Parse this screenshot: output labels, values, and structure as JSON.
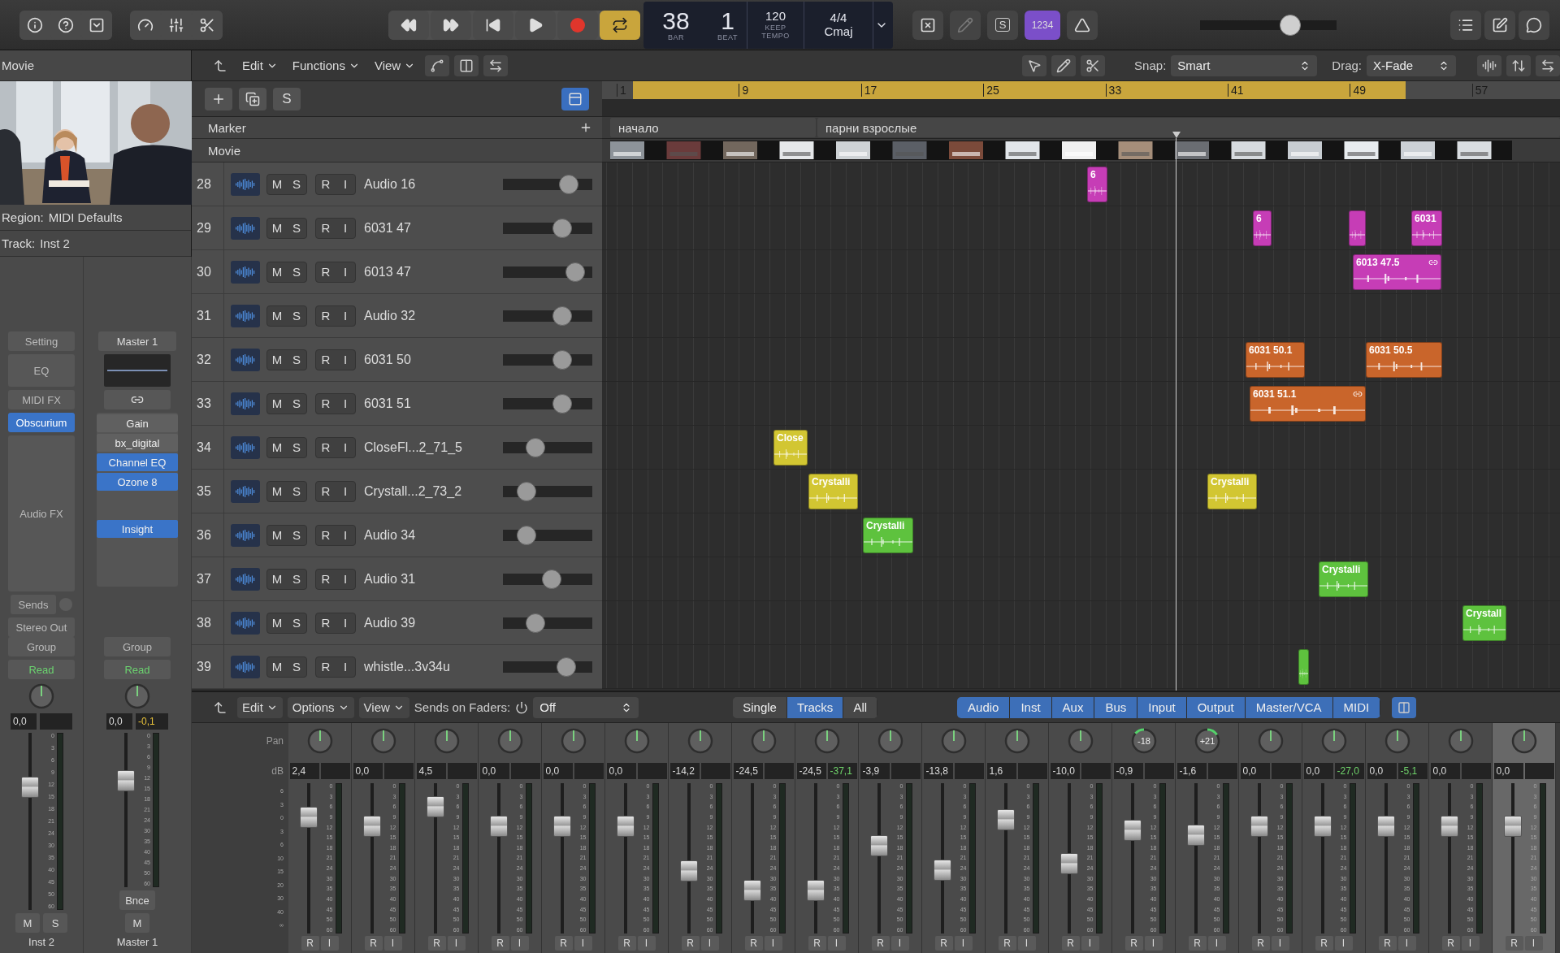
{
  "top_toolbar": {
    "lcd": {
      "bar": "38",
      "bar_label": "BAR",
      "beat": "1",
      "beat_label": "BEAT",
      "tempo": "120",
      "tempo_mode": "KEEP",
      "tempo_label": "TEMPO",
      "signature": "4/4",
      "key": "Cmaj"
    },
    "cycle": {
      "on": true
    },
    "solo_label": "S",
    "count_in": {
      "label": "1234",
      "on": true
    },
    "master_volume": {
      "level": 0.69
    }
  },
  "inspector": {
    "title": "Movie",
    "region": {
      "label": "Region:",
      "value": "MIDI Defaults"
    },
    "track": {
      "label": "Track:",
      "value": "Inst 2"
    },
    "strips": [
      {
        "kind": "instrument",
        "setting": "Setting",
        "eq": "EQ",
        "midi_fx": "MIDI FX",
        "instrument": "Obscurium",
        "audio_fx": "Audio FX",
        "sends": "Sends",
        "output": "Stereo Out",
        "group": "Group",
        "automation": "Read",
        "volume": "0,0",
        "fader": {
          "level": 0.72
        },
        "meter_scale": [
          "0",
          "3",
          "6",
          "9",
          "12",
          "15",
          "18",
          "21",
          "24",
          "30",
          "35",
          "40",
          "45",
          "50",
          "60"
        ],
        "buttons": [
          "M",
          "S"
        ],
        "name": "Inst 2"
      },
      {
        "kind": "master",
        "setting": "Master 1",
        "plugins": [
          {
            "label": "Gain",
            "active": false
          },
          {
            "label": "bx_digital",
            "active": false
          },
          {
            "label": "Channel EQ",
            "active": true
          },
          {
            "label": "Ozone 8",
            "active": true
          }
        ],
        "lower_plugins": [
          {
            "label": "Insight",
            "active": true
          }
        ],
        "group": "Group",
        "automation": "Read",
        "volume": "0,0",
        "peak": "-0,1",
        "fader": {
          "level": 0.72
        },
        "meter_scale": [
          "0",
          "3",
          "6",
          "9",
          "12",
          "15",
          "18",
          "21",
          "24",
          "30",
          "35",
          "40",
          "45",
          "50",
          "60"
        ],
        "bounce": "Bnce",
        "buttons": [
          "M"
        ],
        "name": "Master 1"
      }
    ]
  },
  "arrange": {
    "menus": [
      "Edit",
      "Functions",
      "View"
    ],
    "snap": {
      "label": "Snap:",
      "value": "Smart"
    },
    "drag": {
      "label": "Drag:",
      "value": "X-Fade"
    },
    "solo_label": "S",
    "ruler": [
      "1",
      "9",
      "17",
      "25",
      "33",
      "41",
      "49",
      "57"
    ],
    "global_tracks": [
      "Marker",
      "Movie"
    ],
    "markers": [
      "начало",
      "парни взрослые"
    ],
    "tracks": [
      {
        "number": "28",
        "name": "Audio 16",
        "buttons": [
          "M",
          "S",
          "R",
          "I"
        ],
        "volume": {
          "level": 0.8
        },
        "regions": [
          {
            "name": "6",
            "color": "#c63db6",
            "linked": false
          }
        ]
      },
      {
        "number": "29",
        "name": "6031 47",
        "buttons": [
          "M",
          "S",
          "R",
          "I"
        ],
        "volume": {
          "level": 0.71
        },
        "regions": [
          {
            "name": "6",
            "color": "#c63db6",
            "linked": false
          },
          {
            "color": "#c63db6",
            "linked": false
          },
          {
            "name": "6031",
            "color": "#c63db6",
            "linked": false
          }
        ]
      },
      {
        "number": "30",
        "name": "6013 47",
        "buttons": [
          "M",
          "S",
          "R",
          "I"
        ],
        "volume": {
          "level": 0.89
        },
        "regions": [
          {
            "name": "6013 47.5",
            "color": "#c63db6",
            "linked": true
          }
        ]
      },
      {
        "number": "31",
        "name": "Audio 32",
        "buttons": [
          "M",
          "S",
          "R",
          "I"
        ],
        "volume": {
          "level": 0.71
        }
      },
      {
        "number": "32",
        "name": "6031 50",
        "buttons": [
          "M",
          "S",
          "R",
          "I"
        ],
        "volume": {
          "level": 0.71
        },
        "regions": [
          {
            "name": "6031 50.1",
            "color": "#c9652b",
            "linked": false
          },
          {
            "name": "6031 50.5",
            "color": "#c9652b",
            "linked": false
          }
        ]
      },
      {
        "number": "33",
        "name": "6031 51",
        "buttons": [
          "M",
          "S",
          "R",
          "I"
        ],
        "volume": {
          "level": 0.71
        },
        "regions": [
          {
            "name": "6031 51.1",
            "color": "#c9652b",
            "linked": true
          }
        ]
      },
      {
        "number": "34",
        "name": "CloseFl...2_71_5",
        "buttons": [
          "M",
          "S",
          "R",
          "I"
        ],
        "volume": {
          "level": 0.32
        },
        "regions": [
          {
            "name": "Close",
            "color": "#d2c632",
            "linked": false
          }
        ]
      },
      {
        "number": "35",
        "name": "Crystall...2_73_2",
        "buttons": [
          "M",
          "S",
          "R",
          "I"
        ],
        "volume": {
          "level": 0.2
        },
        "regions": [
          {
            "name": "Crystalli",
            "color": "#d2c632",
            "linked": false
          },
          {
            "name": "Crystalli",
            "color": "#d2c632",
            "linked": false
          }
        ]
      },
      {
        "number": "36",
        "name": "Audio 34",
        "buttons": [
          "M",
          "S",
          "R",
          "I"
        ],
        "volume": {
          "level": 0.2
        },
        "regions": [
          {
            "name": "Crystalli",
            "color": "#5ec23e",
            "linked": false
          }
        ]
      },
      {
        "number": "37",
        "name": "Audio 31",
        "buttons": [
          "M",
          "S",
          "R",
          "I"
        ],
        "volume": {
          "level": 0.56
        },
        "regions": [
          {
            "name": "Crystalli",
            "color": "#5ec23e",
            "linked": false
          }
        ]
      },
      {
        "number": "38",
        "name": "Audio 39",
        "buttons": [
          "M",
          "S",
          "R",
          "I"
        ],
        "volume": {
          "level": 0.33
        },
        "regions": [
          {
            "name": "Crystall",
            "color": "#5ec23e",
            "linked": false
          }
        ]
      },
      {
        "number": "39",
        "name": "whistle...3v34u",
        "buttons": [
          "M",
          "S",
          "R",
          "I"
        ],
        "volume": {
          "level": 0.77
        },
        "regions": [
          {
            "color": "#5ec23e",
            "linked": false
          }
        ]
      }
    ]
  },
  "mixer": {
    "menus": [
      "Edit",
      "Options",
      "View"
    ],
    "sends_label": "Sends on Faders:",
    "sends_value": "Off",
    "views": [
      {
        "label": "Single",
        "selected": false
      },
      {
        "label": "Tracks",
        "selected": true
      },
      {
        "label": "All",
        "selected": false
      }
    ],
    "filters": [
      {
        "label": "Audio",
        "on": true
      },
      {
        "label": "Inst",
        "on": true
      },
      {
        "label": "Aux",
        "on": true
      },
      {
        "label": "Bus",
        "on": true
      },
      {
        "label": "Input",
        "on": true
      },
      {
        "label": "Output",
        "on": true
      },
      {
        "label": "Master/VCA",
        "on": true
      },
      {
        "label": "MIDI",
        "on": true
      }
    ],
    "pan_label": "Pan",
    "db_label": "dB",
    "fader_scale": [
      "6",
      "3",
      "0",
      "3",
      "6",
      "10",
      "15",
      "20",
      "30",
      "40",
      "∞"
    ],
    "strips": [
      {
        "volume": "2,4",
        "fader": {
          "level": 0.82
        },
        "meter_scale": [
          "0",
          "3",
          "6",
          "9",
          "12",
          "15",
          "18",
          "21",
          "24",
          "30",
          "35",
          "40",
          "45",
          "50",
          "60"
        ],
        "buttons": [
          "R",
          "I"
        ],
        "selected": false
      },
      {
        "volume": "0,0",
        "fader": {
          "level": 0.75
        },
        "meter_scale": [
          "0",
          "3",
          "6",
          "9",
          "12",
          "15",
          "18",
          "21",
          "24",
          "30",
          "35",
          "40",
          "45",
          "50",
          "60"
        ],
        "buttons": [
          "R",
          "I"
        ],
        "selected": false
      },
      {
        "volume": "4,5",
        "fader": {
          "level": 0.9
        },
        "meter_scale": [
          "0",
          "3",
          "6",
          "9",
          "12",
          "15",
          "18",
          "21",
          "24",
          "30",
          "35",
          "40",
          "45",
          "50",
          "60"
        ],
        "buttons": [
          "R",
          "I"
        ],
        "selected": false
      },
      {
        "volume": "0,0",
        "fader": {
          "level": 0.75
        },
        "meter_scale": [
          "0",
          "3",
          "6",
          "9",
          "12",
          "15",
          "18",
          "21",
          "24",
          "30",
          "35",
          "40",
          "45",
          "50",
          "60"
        ],
        "buttons": [
          "R",
          "I"
        ],
        "selected": false
      },
      {
        "volume": "0,0",
        "fader": {
          "level": 0.75
        },
        "meter_scale": [
          "0",
          "3",
          "6",
          "9",
          "12",
          "15",
          "18",
          "21",
          "24",
          "30",
          "35",
          "40",
          "45",
          "50",
          "60"
        ],
        "buttons": [
          "R",
          "I"
        ],
        "selected": false
      },
      {
        "volume": "0,0",
        "fader": {
          "level": 0.75
        },
        "meter_scale": [
          "0",
          "3",
          "6",
          "9",
          "12",
          "15",
          "18",
          "21",
          "24",
          "30",
          "35",
          "40",
          "45",
          "50",
          "60"
        ],
        "buttons": [
          "R",
          "I"
        ],
        "selected": false
      },
      {
        "volume": "-14,2",
        "fader": {
          "level": 0.4
        },
        "meter_scale": [
          "0",
          "3",
          "6",
          "9",
          "12",
          "15",
          "18",
          "21",
          "24",
          "30",
          "35",
          "40",
          "45",
          "50",
          "60"
        ],
        "buttons": [
          "R",
          "I"
        ],
        "selected": false
      },
      {
        "volume": "-24,5",
        "fader": {
          "level": 0.25
        },
        "meter_scale": [
          "0",
          "3",
          "6",
          "9",
          "12",
          "15",
          "18",
          "21",
          "24",
          "30",
          "35",
          "40",
          "45",
          "50",
          "60"
        ],
        "buttons": [
          "R",
          "I"
        ],
        "selected": false
      },
      {
        "volume": "-24,5",
        "peak": "-37,1",
        "fader": {
          "level": 0.25
        },
        "meter_scale": [
          "0",
          "3",
          "6",
          "9",
          "12",
          "15",
          "18",
          "21",
          "24",
          "30",
          "35",
          "40",
          "45",
          "50",
          "60"
        ],
        "buttons": [
          "R",
          "I"
        ],
        "selected": false
      },
      {
        "volume": "-3,9",
        "fader": {
          "level": 0.6
        },
        "meter_scale": [
          "0",
          "3",
          "6",
          "9",
          "12",
          "15",
          "18",
          "21",
          "24",
          "30",
          "35",
          "40",
          "45",
          "50",
          "60"
        ],
        "buttons": [
          "R",
          "I"
        ],
        "selected": false
      },
      {
        "volume": "-13,8",
        "fader": {
          "level": 0.41
        },
        "meter_scale": [
          "0",
          "3",
          "6",
          "9",
          "12",
          "15",
          "18",
          "21",
          "24",
          "30",
          "35",
          "40",
          "45",
          "50",
          "60"
        ],
        "buttons": [
          "R",
          "I"
        ],
        "selected": false
      },
      {
        "volume": "1,6",
        "fader": {
          "level": 0.8
        },
        "meter_scale": [
          "0",
          "3",
          "6",
          "9",
          "12",
          "15",
          "18",
          "21",
          "24",
          "30",
          "35",
          "40",
          "45",
          "50",
          "60"
        ],
        "buttons": [
          "R",
          "I"
        ],
        "selected": false
      },
      {
        "volume": "-10,0",
        "fader": {
          "level": 0.46
        },
        "meter_scale": [
          "0",
          "3",
          "6",
          "9",
          "12",
          "15",
          "18",
          "21",
          "24",
          "30",
          "35",
          "40",
          "45",
          "50",
          "60"
        ],
        "buttons": [
          "R",
          "I"
        ],
        "selected": false
      },
      {
        "pan": {
          "reading": "-18",
          "left": true
        },
        "volume": "-0,9",
        "fader": {
          "level": 0.72
        },
        "meter_scale": [
          "0",
          "3",
          "6",
          "9",
          "12",
          "15",
          "18",
          "21",
          "24",
          "30",
          "35",
          "40",
          "45",
          "50",
          "60"
        ],
        "buttons": [
          "R",
          "I"
        ],
        "selected": false
      },
      {
        "pan": {
          "reading": "+21",
          "left": false
        },
        "volume": "-1,6",
        "fader": {
          "level": 0.68
        },
        "meter_scale": [
          "0",
          "3",
          "6",
          "9",
          "12",
          "15",
          "18",
          "21",
          "24",
          "30",
          "35",
          "40",
          "45",
          "50",
          "60"
        ],
        "buttons": [
          "R",
          "I"
        ],
        "selected": false
      },
      {
        "volume": "0,0",
        "fader": {
          "level": 0.75
        },
        "meter_scale": [
          "0",
          "3",
          "6",
          "9",
          "12",
          "15",
          "18",
          "21",
          "24",
          "30",
          "35",
          "40",
          "45",
          "50",
          "60"
        ],
        "buttons": [
          "R",
          "I"
        ],
        "selected": false
      },
      {
        "volume": "0,0",
        "peak": "-27,0",
        "fader": {
          "level": 0.75
        },
        "meter_scale": [
          "0",
          "3",
          "6",
          "9",
          "12",
          "15",
          "18",
          "21",
          "24",
          "30",
          "35",
          "40",
          "45",
          "50",
          "60"
        ],
        "buttons": [
          "R",
          "I"
        ],
        "selected": false
      },
      {
        "volume": "0,0",
        "peak": "-5,1",
        "fader": {
          "level": 0.75
        },
        "meter_scale": [
          "0",
          "3",
          "6",
          "9",
          "12",
          "15",
          "18",
          "21",
          "24",
          "30",
          "35",
          "40",
          "45",
          "50",
          "60"
        ],
        "buttons": [
          "R",
          "I"
        ],
        "selected": false
      },
      {
        "volume": "0,0",
        "fader": {
          "level": 0.75
        },
        "meter_scale": [
          "0",
          "3",
          "6",
          "9",
          "12",
          "15",
          "18",
          "21",
          "24",
          "30",
          "35",
          "40",
          "45",
          "50",
          "60"
        ],
        "buttons": [
          "R",
          "I"
        ],
        "selected": false
      },
      {
        "volume": "0,0",
        "fader": {
          "level": 0.75
        },
        "meter_scale": [
          "0",
          "3",
          "6",
          "9",
          "12",
          "15",
          "18",
          "21",
          "24",
          "30",
          "35",
          "40",
          "45",
          "50",
          "60"
        ],
        "buttons": [
          "R",
          "I"
        ],
        "selected": true
      }
    ]
  }
}
